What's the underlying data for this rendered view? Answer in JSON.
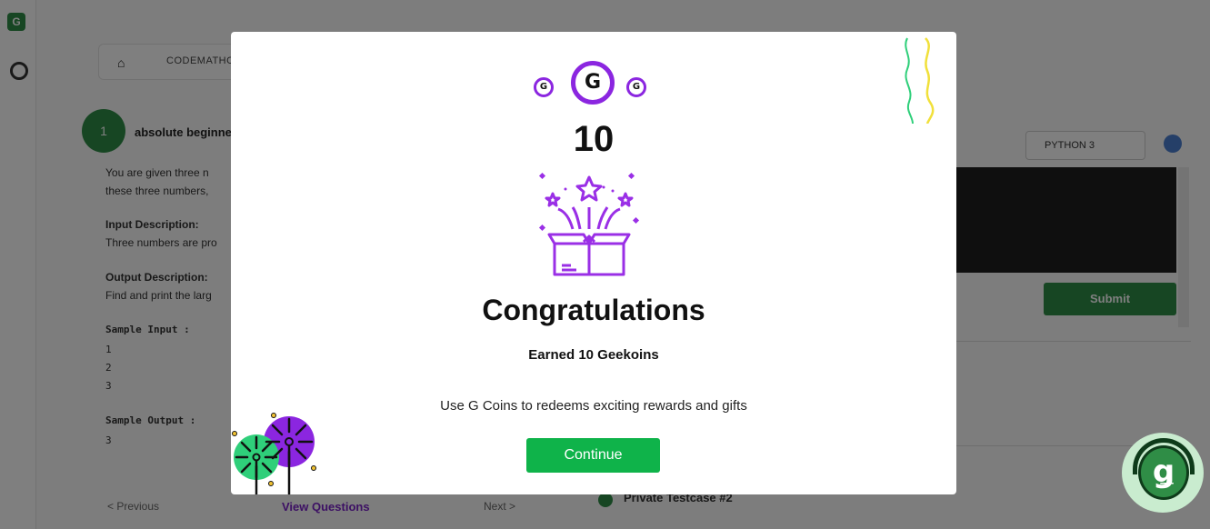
{
  "background": {
    "nav": {
      "home_icon": "home-icon",
      "breadcrumb": "CODEMATHON"
    },
    "problem": {
      "avatar_initial": "1",
      "level": "absolute beginner",
      "statement_line1": "You are given three n",
      "statement_line2": "these three numbers,",
      "input_heading": "Input Description:",
      "input_text": "Three numbers are pro",
      "output_heading": "Output Description:",
      "output_text": "Find and print the larg",
      "sample_input_label": "Sample Input :",
      "sample_input": [
        "1",
        "2",
        "3"
      ],
      "sample_output_label": "Sample Output :",
      "sample_output": [
        "3"
      ]
    },
    "pager": {
      "previous": "< Previous",
      "view": "View Questions",
      "next": "Next >"
    },
    "editor": {
      "language": "PYTHON 3",
      "submit": "Submit"
    },
    "testcase": {
      "label": "Private Testcase #2"
    }
  },
  "modal": {
    "coin_letter": "G",
    "amount": "10",
    "title": "Congratulations",
    "earned": "Earned 10 Geekoins",
    "info": "Use G Coins to redeems exciting rewards and gifts",
    "continue_label": "Continue",
    "colors": {
      "accent": "#8b26e0",
      "button": "#0fb34a",
      "streamer_green": "#2fcf7a",
      "streamer_yellow": "#f1e03a"
    }
  },
  "support": {
    "glyph": "ǥ",
    "icon": "support-headset-icon"
  }
}
